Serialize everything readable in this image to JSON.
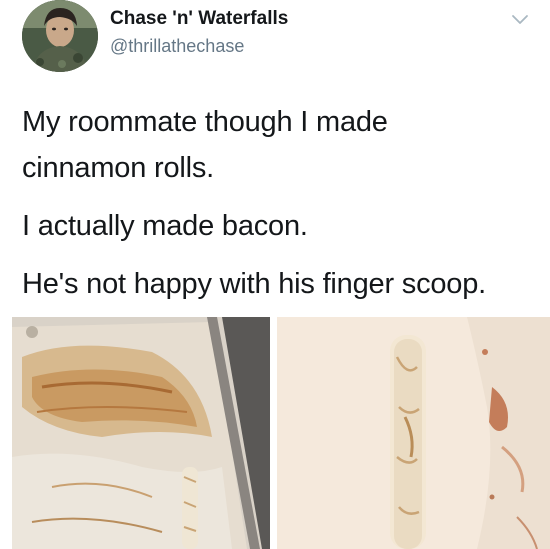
{
  "tweet": {
    "display_name": "Chase 'n' Waterfalls",
    "handle": "@thrillathechase",
    "lines": [
      "My roommate though I made",
      "cinnamon rolls.",
      "I actually made bacon.",
      "He's not happy with his finger scoop."
    ]
  },
  "icons": {
    "menu": "chevron-down-icon",
    "avatar": "profile-photo"
  },
  "colors": {
    "text": "#14171a",
    "secondary_text": "#657786",
    "background": "#ffffff"
  }
}
